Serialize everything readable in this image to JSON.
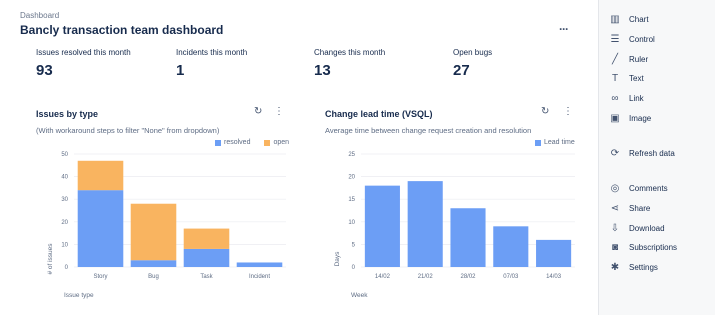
{
  "header": {
    "breadcrumb": "Dashboard",
    "title": "Bancly transaction team dashboard",
    "more": "···"
  },
  "kpis": [
    {
      "label": "Issues resolved this month",
      "value": "93"
    },
    {
      "label": "Incidents this month",
      "value": "1"
    },
    {
      "label": "Changes this month",
      "value": "13"
    },
    {
      "label": "Open bugs",
      "value": "27"
    }
  ],
  "card1": {
    "title": "Issues by type",
    "subtitle": "(With workaround steps to filter \"None\" from dropdown)",
    "refresh_icon": "↻",
    "more_icon": "⋮"
  },
  "card2": {
    "title": "Change lead time (VSQL)",
    "subtitle": "Average time between change request creation and resolution",
    "refresh_icon": "↻",
    "more_icon": "⋮"
  },
  "colors": {
    "resolved": "#6c9ef5",
    "open": "#f9b460",
    "lead": "#6c9ef5"
  },
  "chart_data": [
    {
      "type": "bar",
      "stacked": true,
      "categories": [
        "Story",
        "Bug",
        "Task",
        "Incident"
      ],
      "series": [
        {
          "name": "resolved",
          "values": [
            34,
            3,
            8,
            2
          ]
        },
        {
          "name": "open",
          "values": [
            13,
            25,
            9,
            0
          ]
        }
      ],
      "xlabel": "Issue type",
      "ylabel": "# of issues",
      "ylim": [
        0,
        50
      ],
      "yticks": [
        "0",
        "10",
        "20",
        "30",
        "40",
        "50"
      ],
      "legend": "top-right",
      "grid": true
    },
    {
      "type": "bar",
      "categories": [
        "14/02",
        "21/02",
        "28/02",
        "07/03",
        "14/03"
      ],
      "series": [
        {
          "name": "Lead time",
          "values": [
            18,
            19,
            13,
            9,
            6
          ]
        }
      ],
      "xlabel": "Week",
      "ylabel": "Days",
      "ylim": [
        0,
        25
      ],
      "yticks": [
        "0",
        "5",
        "10",
        "15",
        "20",
        "25"
      ],
      "legend": "top-right",
      "grid": true
    }
  ],
  "sidebar": {
    "items": [
      {
        "label": "Chart",
        "icon": "▥",
        "icon_name": "chart-icon"
      },
      {
        "label": "Control",
        "icon": "☰",
        "icon_name": "control-icon"
      },
      {
        "label": "Ruler",
        "icon": "╱",
        "icon_name": "ruler-icon"
      },
      {
        "label": "Text",
        "icon": "T",
        "icon_name": "text-icon"
      },
      {
        "label": "Link",
        "icon": "∞",
        "icon_name": "link-icon"
      },
      {
        "label": "Image",
        "icon": "▣",
        "icon_name": "image-icon"
      },
      {
        "label": "Refresh data",
        "icon": "⟳",
        "icon_name": "refresh-icon"
      },
      {
        "label": "Comments",
        "icon": "◎",
        "icon_name": "comments-icon"
      },
      {
        "label": "Share",
        "icon": "⋖",
        "icon_name": "share-icon"
      },
      {
        "label": "Download",
        "icon": "⇩",
        "icon_name": "download-icon"
      },
      {
        "label": "Subscriptions",
        "icon": "◙",
        "icon_name": "subscriptions-icon"
      },
      {
        "label": "Settings",
        "icon": "✱",
        "icon_name": "settings-icon"
      }
    ]
  }
}
